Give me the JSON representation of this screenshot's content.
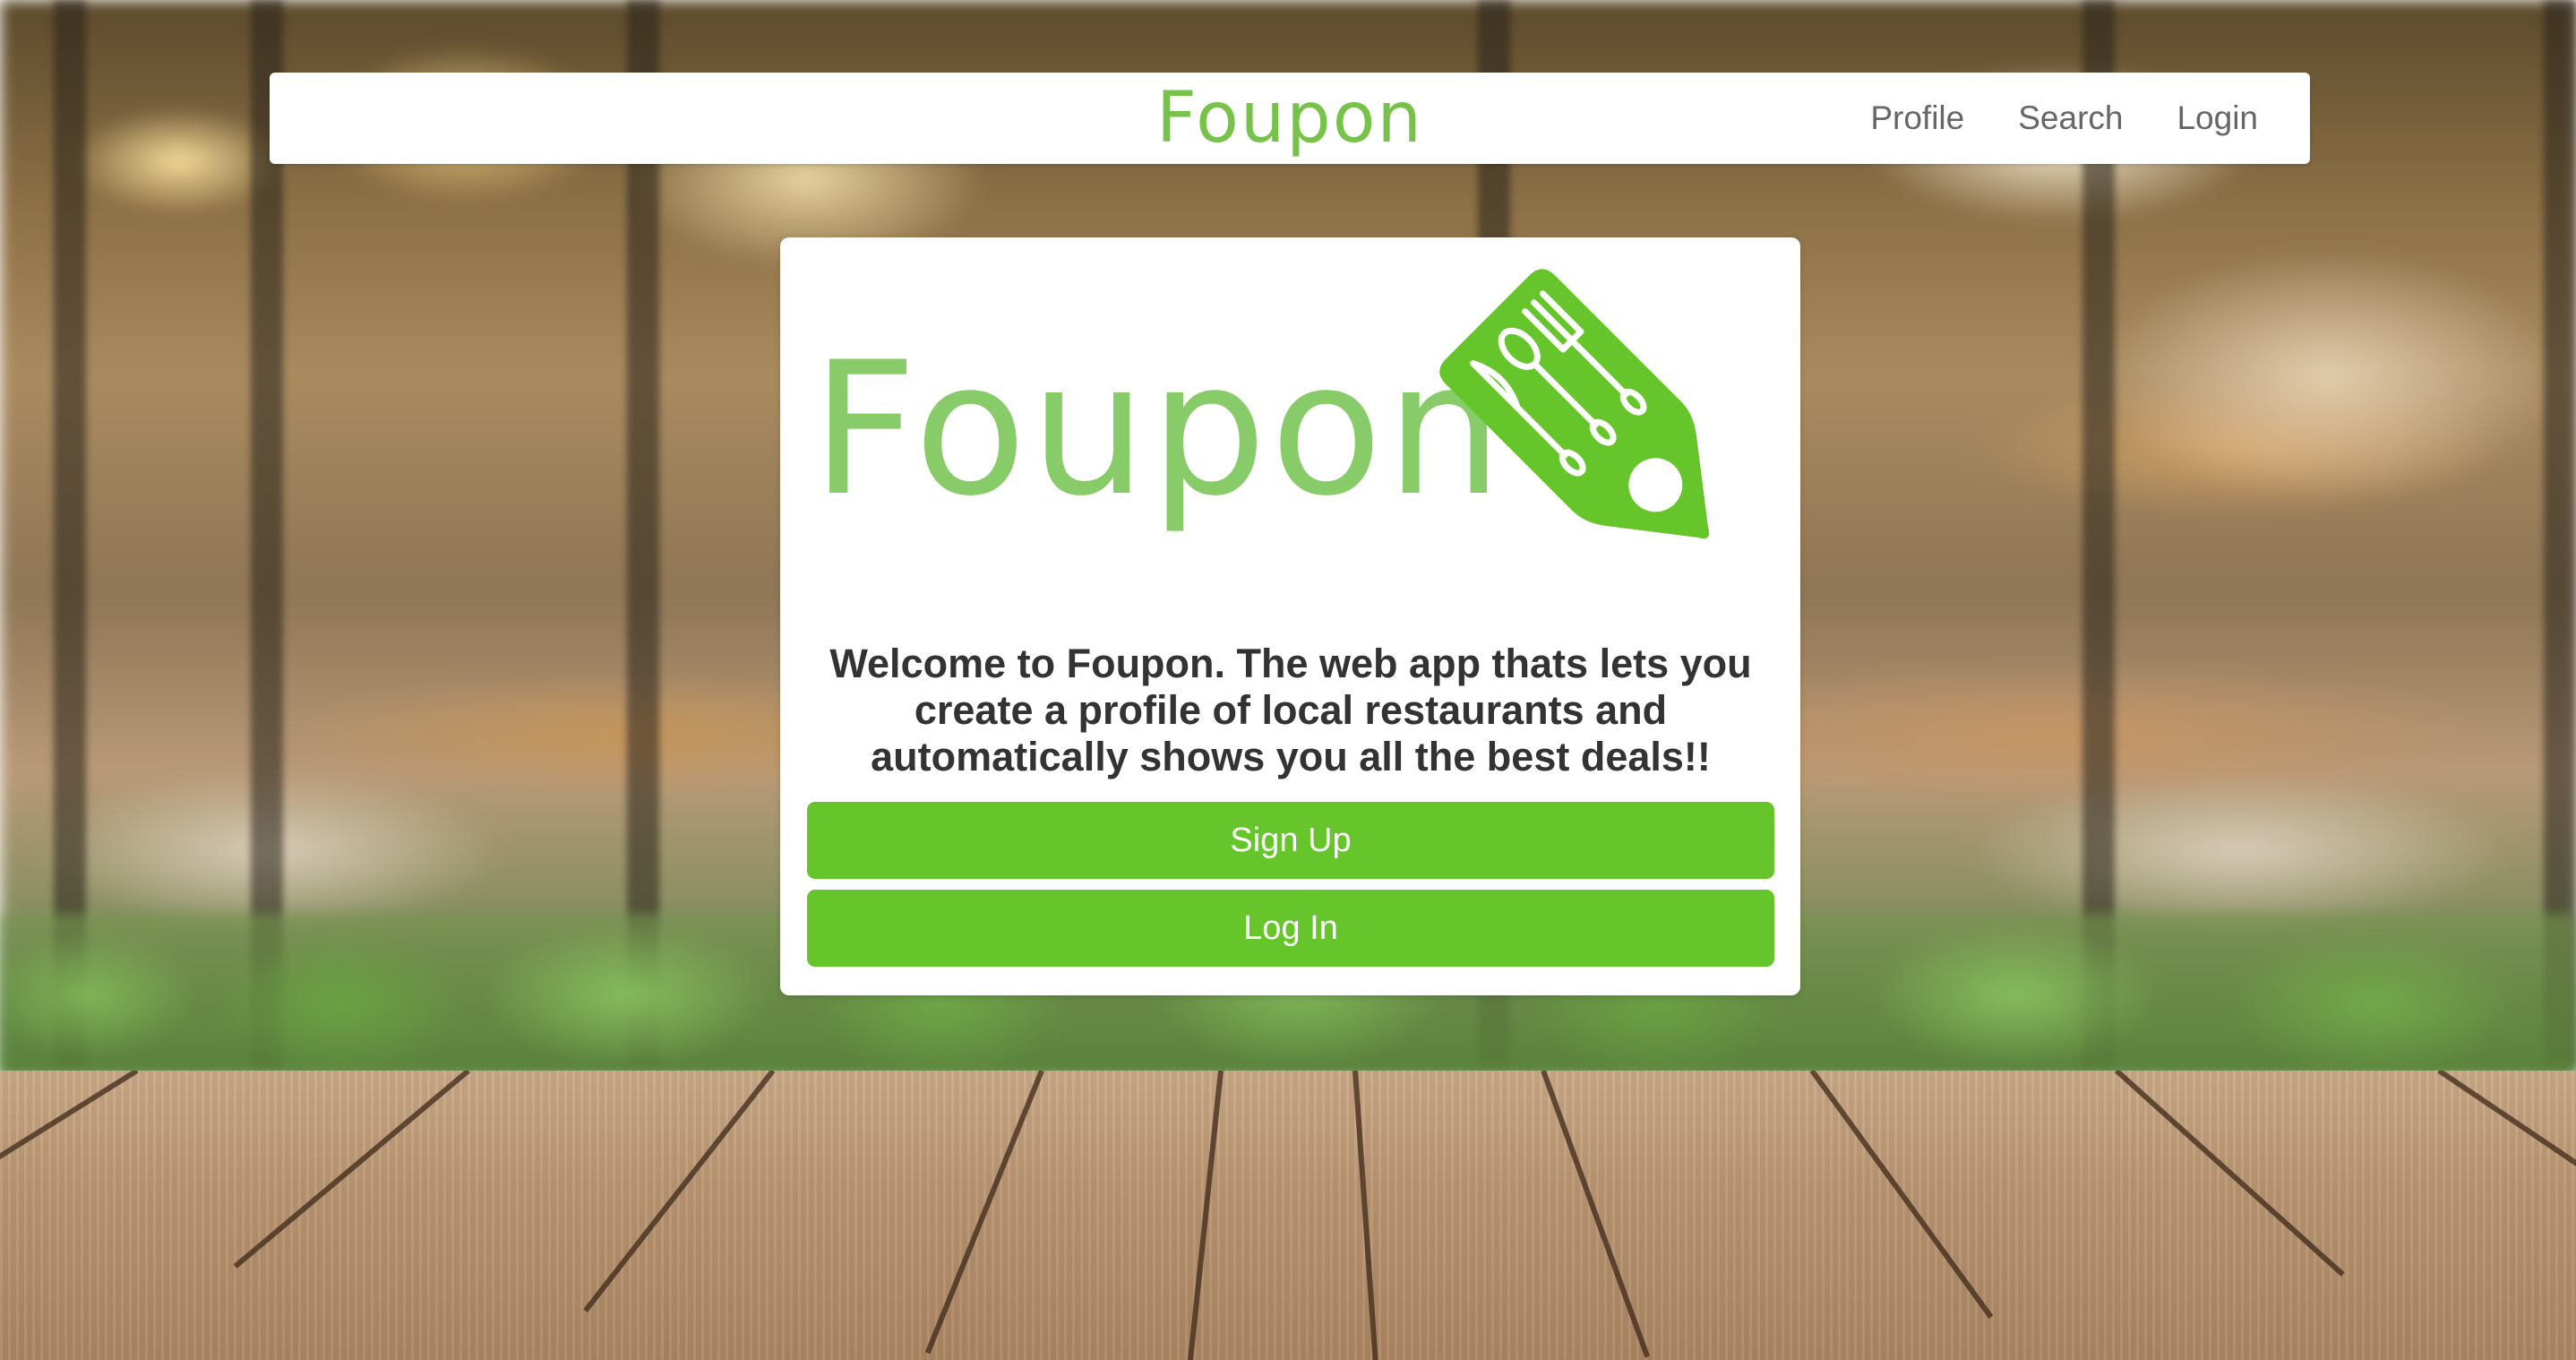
{
  "navbar": {
    "brand": "Foupon",
    "links": [
      {
        "label": "Profile"
      },
      {
        "label": "Search"
      },
      {
        "label": "Login"
      }
    ]
  },
  "card": {
    "logo_text": "Foupon",
    "welcome": "Welcome to Foupon. The web app thats lets you create a profile of local restaurants and automatically shows you all the best deals!!",
    "signup_label": "Sign Up",
    "login_label": "Log In"
  },
  "colors": {
    "brand_green": "#77c34a",
    "button_green": "#66c52b",
    "tag_green": "#66c52b"
  },
  "icons": [
    "fork-icon",
    "spoon-icon",
    "knife-icon",
    "price-tag-icon"
  ]
}
